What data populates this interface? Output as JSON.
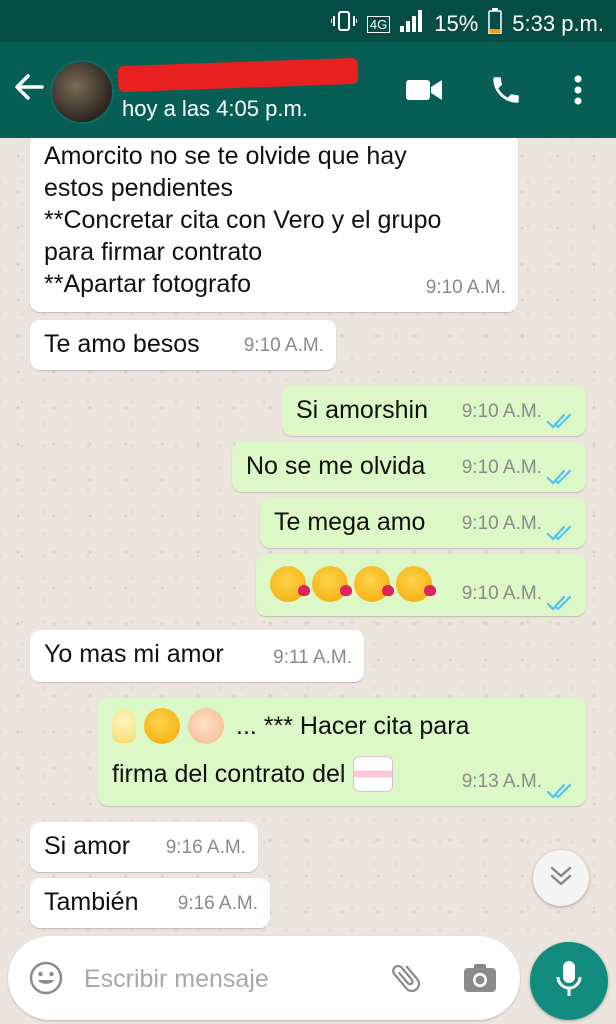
{
  "status_bar": {
    "network": "4G",
    "battery": "15%",
    "time": "5:33 p.m."
  },
  "header": {
    "last_seen": "hoy a las 4:05 p.m.",
    "icons": [
      "back-arrow-icon",
      "video-call-icon",
      "phone-icon",
      "more-vert-icon"
    ]
  },
  "messages": [
    {
      "dir": "in",
      "text": "Amorcito no se te olvide que hay\nestos pendientes\n**Concretar cita con Vero y el grupo\npara firmar contrato\n**Apartar fotografo",
      "time": "9:10 A.M."
    },
    {
      "dir": "in",
      "text": "Te amo besos",
      "time": "9:10 A.M."
    },
    {
      "dir": "out",
      "text": "Si amorshin",
      "time": "9:10 A.M."
    },
    {
      "dir": "out",
      "text": "No se me olvida",
      "time": "9:10 A.M."
    },
    {
      "dir": "out",
      "text": "Te mega amo",
      "time": "9:10 A.M."
    },
    {
      "dir": "out",
      "emojis": [
        "face-blowing-kiss",
        "face-blowing-kiss",
        "face-blowing-kiss",
        "face-blowing-kiss"
      ],
      "time": "9:10 A.M."
    },
    {
      "dir": "in",
      "text": "Yo mas mi amor",
      "time": "9:11 A.M."
    },
    {
      "dir": "out",
      "text_line1": "... *** Hacer cita para",
      "text_line2": "firma del contrato del",
      "emojis": [
        "light-bulb",
        "relieved-face",
        "ok-hand",
        "birthday-cake"
      ],
      "time": "9:13 A.M."
    },
    {
      "dir": "in",
      "text": "Si amor",
      "time": "9:16 A.M."
    },
    {
      "dir": "in",
      "text": "También",
      "time": "9:16 A.M."
    }
  ],
  "composer": {
    "placeholder": "Escribir mensaje",
    "icons": [
      "emoji-icon",
      "attach-icon",
      "camera-icon",
      "mic-icon"
    ]
  },
  "colors": {
    "header": "#075e54",
    "status_bar": "#054d44",
    "outgoing_bubble": "#dcf8c6",
    "incoming_bubble": "#ffffff",
    "read_ticks": "#4fc3f7",
    "mic_button": "#128c7e"
  }
}
